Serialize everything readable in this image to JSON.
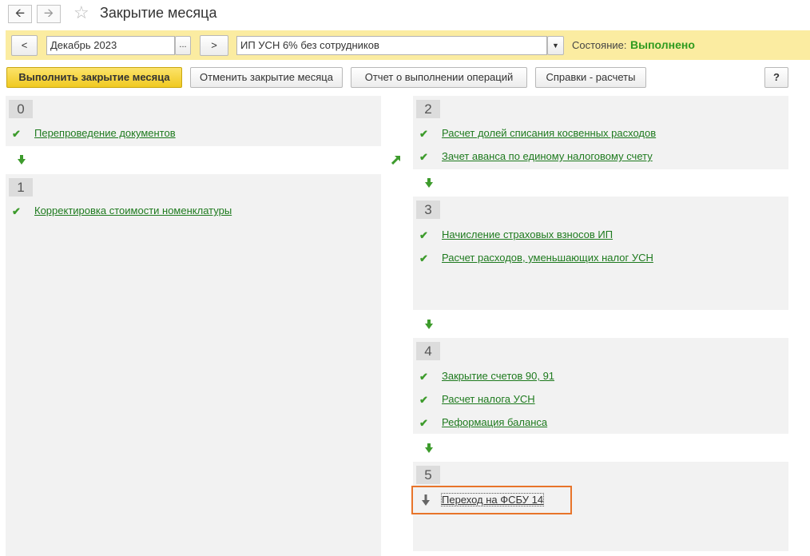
{
  "header": {
    "back_icon": "arrow-left-icon",
    "forward_icon": "arrow-right-icon",
    "favorite_icon": "star-outline-icon",
    "title": "Закрытие месяца"
  },
  "toolbar": {
    "prev_label": "<",
    "period_value": "Декабрь 2023",
    "period_select_label": "...",
    "next_label": ">",
    "org_value": "ИП УСН 6% без сотрудников",
    "state_label": "Состояние:",
    "state_value": "Выполнено",
    "state_color": "#2e9b1e"
  },
  "actions": {
    "run_label": "Выполнить закрытие месяца",
    "cancel_label": "Отменить закрытие месяца",
    "report_label": "Отчет о выполнении операций",
    "reference_label": "Справки - расчеты",
    "help_label": "?"
  },
  "stages": [
    {
      "number": "0",
      "items": [
        {
          "label": "Перепроведение документов",
          "status": "done"
        }
      ]
    },
    {
      "number": "1",
      "items": [
        {
          "label": "Корректировка стоимости номенклатуры",
          "status": "done"
        }
      ]
    },
    {
      "number": "2",
      "items": [
        {
          "label": "Расчет долей списания косвенных расходов",
          "status": "done"
        },
        {
          "label": "Зачет аванса по единому налоговому счету",
          "status": "done"
        }
      ]
    },
    {
      "number": "3",
      "items": [
        {
          "label": "Начисление страховых взносов ИП",
          "status": "done"
        },
        {
          "label": "Расчет расходов, уменьшающих налог УСН",
          "status": "done"
        }
      ]
    },
    {
      "number": "4",
      "items": [
        {
          "label": "Закрытие счетов 90, 91",
          "status": "done"
        },
        {
          "label": "Расчет налога УСН",
          "status": "done"
        },
        {
          "label": "Реформация баланса",
          "status": "done"
        }
      ]
    },
    {
      "number": "5",
      "items": [
        {
          "label": "Переход на ФСБУ 14",
          "status": "pending"
        }
      ]
    }
  ],
  "colors": {
    "accent_green": "#3d9b2c",
    "highlight_orange": "#e8742a",
    "primary_button": "#f5d33a"
  }
}
